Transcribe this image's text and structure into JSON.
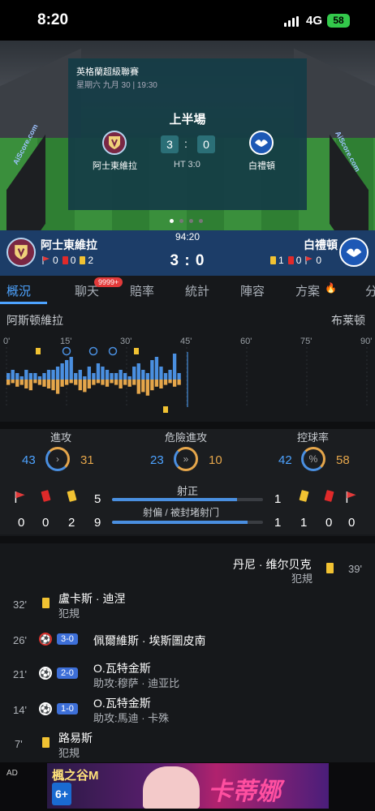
{
  "status": {
    "time": "8:20",
    "network": "4G",
    "battery": "58"
  },
  "match_card": {
    "league": "英格蘭超級聯賽",
    "date": "星期六 九月 30 | 19:30",
    "period": "上半場",
    "home_score": "3",
    "separator": ":",
    "away_score": "0",
    "home_name": "阿士東維拉",
    "away_name": "白禮頓",
    "ht": "HT 3:0",
    "watermark": "AiScore.com"
  },
  "scorebar": {
    "time": "94:20",
    "score": "3 : 0",
    "home_name": "阿士東維拉",
    "away_name": "白禮頓",
    "home_corners": "0",
    "home_red": "0",
    "home_yellow": "2",
    "away_yellow": "1",
    "away_red": "0",
    "away_corners": "0"
  },
  "tabs": [
    {
      "label": "概況"
    },
    {
      "label": "聊天"
    },
    {
      "label": "賠率"
    },
    {
      "label": "統計"
    },
    {
      "label": "陣容"
    },
    {
      "label": "方案"
    },
    {
      "label": "分"
    }
  ],
  "chat_badge": "9999+",
  "momentum": {
    "home_label": "阿斯顿維拉",
    "away_label": "布莱顿",
    "ticks": [
      "0'",
      "15'",
      "30'",
      "45'",
      "60'",
      "75'",
      "90'"
    ],
    "home_bars": [
      2,
      3,
      2,
      1,
      3,
      2,
      2,
      1,
      2,
      3,
      3,
      4,
      5,
      6,
      7,
      2,
      3,
      1,
      4,
      2,
      5,
      4,
      3,
      2,
      2,
      3,
      2,
      1,
      4,
      5,
      3,
      2,
      6,
      7,
      4,
      2,
      3,
      8,
      2
    ],
    "away_bars": [
      3,
      2,
      4,
      3,
      5,
      6,
      2,
      3,
      4,
      5,
      6,
      8,
      4,
      3,
      2,
      3,
      6,
      7,
      5,
      3,
      2,
      3,
      4,
      2,
      3,
      5,
      3,
      4,
      3,
      8,
      7,
      9,
      6,
      4,
      5,
      3,
      2,
      4,
      3
    ],
    "colors": {
      "home": "#4a8fe0",
      "away": "#e5a64b"
    }
  },
  "stats": {
    "attack": {
      "label": "進攻",
      "home": "43",
      "away": "31"
    },
    "dangerous": {
      "label": "危險進攻",
      "home": "23",
      "away": "10"
    },
    "possession": {
      "label": "控球率",
      "home": "42",
      "away": "58",
      "symbol": "%"
    },
    "home_counts": {
      "corners": "0",
      "red": "0",
      "yellow": "2",
      "shots_on": "5",
      "shots_off": "9"
    },
    "away_counts": {
      "corners": "0",
      "red": "0",
      "yellow": "1",
      "shots_on": "1",
      "shots_off": "1"
    },
    "shots_on_label": "射正",
    "shots_off_label": "射偏 / 被封堵射门",
    "shots_on_home_share": 0.83,
    "shots_off_home_share": 0.9
  },
  "events": [
    {
      "minute": "39'",
      "side": "away",
      "type": "yellow",
      "name": "丹尼 · 维尔贝克",
      "sub": "犯規"
    },
    {
      "minute": "32'",
      "side": "home",
      "type": "yellow",
      "name": "盧卡斯 · 迪涅",
      "sub": "犯規"
    },
    {
      "minute": "26'",
      "side": "home",
      "type": "goal-own",
      "score": "3-0",
      "name": "佩爾維斯 · 埃斯圖皮南",
      "sub": ""
    },
    {
      "minute": "21'",
      "side": "home",
      "type": "goal",
      "score": "2-0",
      "name": "O.瓦特金斯",
      "sub": "助攻:穆萨 · 迪亚比"
    },
    {
      "minute": "14'",
      "side": "home",
      "type": "goal",
      "score": "1-0",
      "name": "O.瓦特金斯",
      "sub": "助攻:馬迪 · 卡殊"
    },
    {
      "minute": "7'",
      "side": "home",
      "type": "yellow",
      "name": "路易斯",
      "sub": "犯規"
    }
  ],
  "ad": {
    "label": "AD",
    "title": "楓之谷M",
    "rating": "6+",
    "headline": "卡蒂娜"
  }
}
